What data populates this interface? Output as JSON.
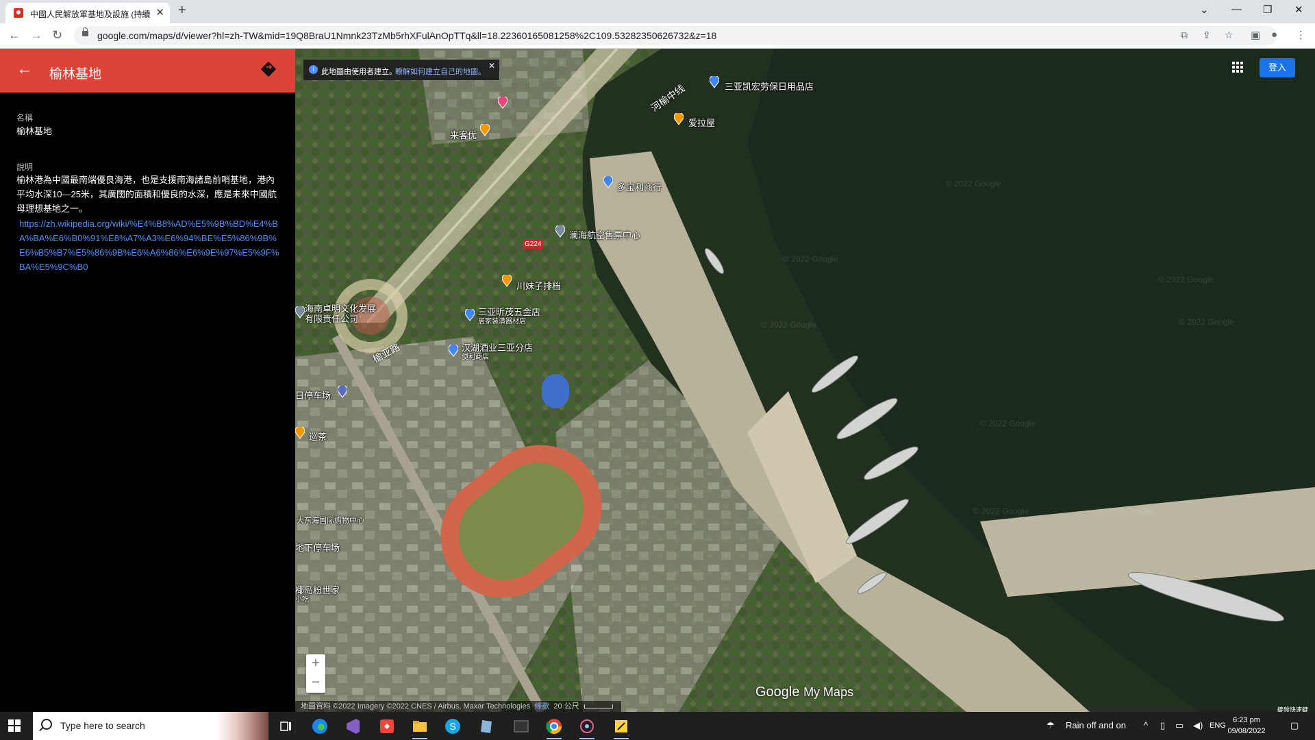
{
  "browser": {
    "tab_title": "中國人民解放軍基地及設施 (持續",
    "url": "google.com/maps/d/viewer?hl=zh-TW&mid=19Q8BraU1Nmnk23TzMb5rhXFulAnOpTTq&ll=18.22360165081258%2C109.53282350626732&z=18",
    "icons": [
      "back-icon",
      "forward-icon",
      "reload-icon",
      "lock-icon",
      "translate-icon",
      "share-icon",
      "star-icon",
      "extensions-icon",
      "profile-icon",
      "menu-icon"
    ]
  },
  "panel": {
    "title": "榆林基地",
    "name_label": "名稱",
    "name_value": "榆林基地",
    "desc_label": "說明",
    "desc_value": "榆林港為中國最南端優良海港，也是支援南海諸島前哨基地，港內平均水深10—25米，其廣闊的面積和優良的水深，應是未來中國航母理想基地之一。",
    "wiki_link": "https://zh.wikipedia.org/wiki/%E4%B8%AD%E5%9B%BD%E4%BA%BA%E6%B0%91%E8%A7%A3%E6%94%BE%E5%86%9B%E6%B5%B7%E5%86%9B%E6%A6%86%E6%9E%97%E5%9F%BA%E5%9C%B0",
    "header_color": "#db4437"
  },
  "map": {
    "notice_text": "此地圖由使用者建立。",
    "notice_link": "瞭解如何建立自己的地圖。",
    "signin_label": "登入",
    "road_labels": [
      "河榆中线",
      "榆亚路"
    ],
    "route_shield": "G224",
    "pois": [
      {
        "name": "三亚凯宏劳保日用品店",
        "sub": ""
      },
      {
        "name": "爱拉屋",
        "sub": ""
      },
      {
        "name": "来客优",
        "sub": ""
      },
      {
        "name": "多宝利商行",
        "sub": ""
      },
      {
        "name": "澜海航空售票中心",
        "sub": ""
      },
      {
        "name": "川妹子排档",
        "sub": ""
      },
      {
        "name": "海南卓明文化发展",
        "sub": "有限责任公司"
      },
      {
        "name": "三亚昕茂五金店",
        "sub": "居家装潢器材店"
      },
      {
        "name": "汉湖酒业三亚分店",
        "sub": "便利商店"
      },
      {
        "name": "日停车场",
        "sub": ""
      },
      {
        "name": "巡茶",
        "sub": ""
      },
      {
        "name": "大东海国际购物中心",
        "sub": ""
      },
      {
        "name": "地下停车场",
        "sub": ""
      },
      {
        "name": "椰岛粉世家",
        "sub": "小吃"
      }
    ],
    "attribution": "地圖資料 ©2022 Imagery ©2022 CNES / Airbus, Maxar Technologies",
    "terms": "條款",
    "scale": "20 公尺",
    "logo_google": "Google",
    "logo_mymaps": "My Maps",
    "watermark": "© 2022 Google",
    "corner_note": "鍵盤快速鍵",
    "zoom_in": "+",
    "zoom_out": "−"
  },
  "taskbar": {
    "search_placeholder": "Type here to search",
    "weather": "Rain off and on",
    "language": "ENG",
    "time": "6:23 pm",
    "date": "09/08/2022"
  }
}
